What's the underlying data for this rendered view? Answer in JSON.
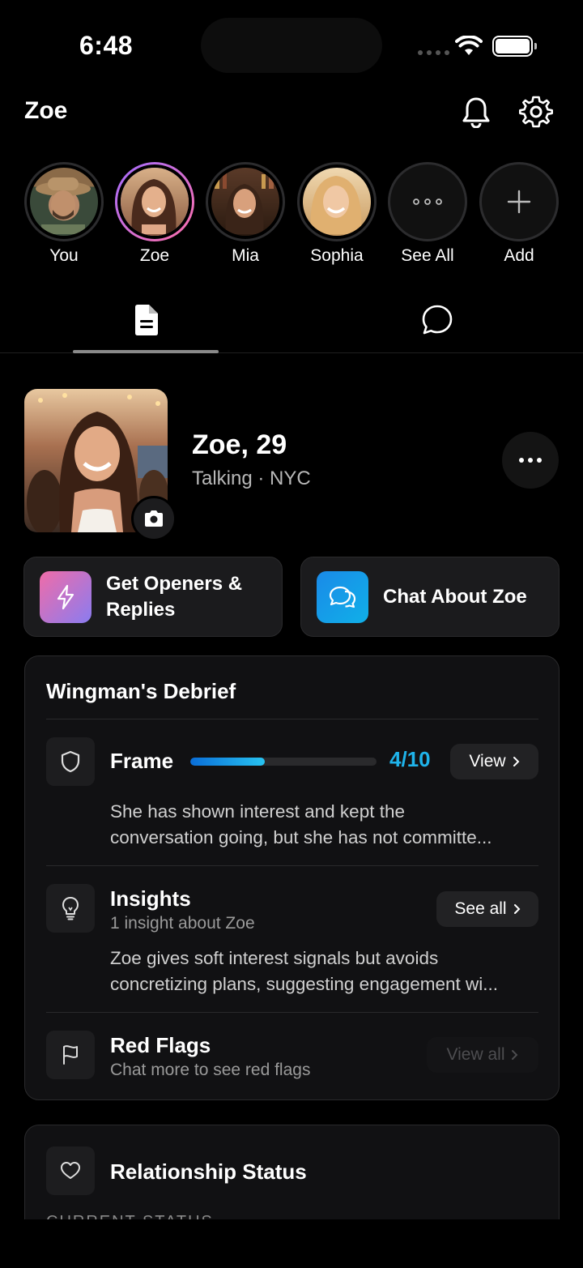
{
  "status_bar": {
    "time": "6:48"
  },
  "header": {
    "title": "Zoe"
  },
  "stories": [
    {
      "label": "You"
    },
    {
      "label": "Zoe"
    },
    {
      "label": "Mia"
    },
    {
      "label": "Sophia"
    },
    {
      "label": "See All"
    },
    {
      "label": "Add"
    }
  ],
  "profile": {
    "name_age": "Zoe, 29",
    "subtitle": "Talking · NYC"
  },
  "actions": {
    "openers_line1": "Get Openers &",
    "openers_line2": "Replies",
    "chat_label": "Chat About Zoe"
  },
  "debrief": {
    "title": "Wingman's Debrief",
    "frame": {
      "title": "Frame",
      "score_text": "4/10",
      "score_fraction": 0.4,
      "button": "View",
      "body_line1": "She has shown interest and kept the",
      "body_line2": "conversation going, but she has not committe..."
    },
    "insights": {
      "title": "Insights",
      "subtitle": "1 insight about Zoe",
      "button": "See all",
      "body_line1": "Zoe gives soft interest signals but avoids",
      "body_line2": "concretizing plans, suggesting engagement wi..."
    },
    "red_flags": {
      "title": "Red Flags",
      "subtitle": "Chat more to see red flags",
      "button": "View all"
    }
  },
  "relationship": {
    "title": "Relationship Status",
    "section_label": "CURRENT STATUS"
  },
  "colors": {
    "accent": "#1fb3ea",
    "background": "#000000",
    "card": "#111113"
  },
  "icons": [
    "wifi-icon",
    "bell-icon",
    "gear-icon",
    "document-icon",
    "chat-bubble-icon",
    "camera-icon",
    "bolt-icon",
    "chat-bubbles-icon",
    "shield-icon",
    "lightbulb-icon",
    "flag-icon",
    "heart-icon",
    "chevron-right-icon",
    "plus-icon"
  ]
}
